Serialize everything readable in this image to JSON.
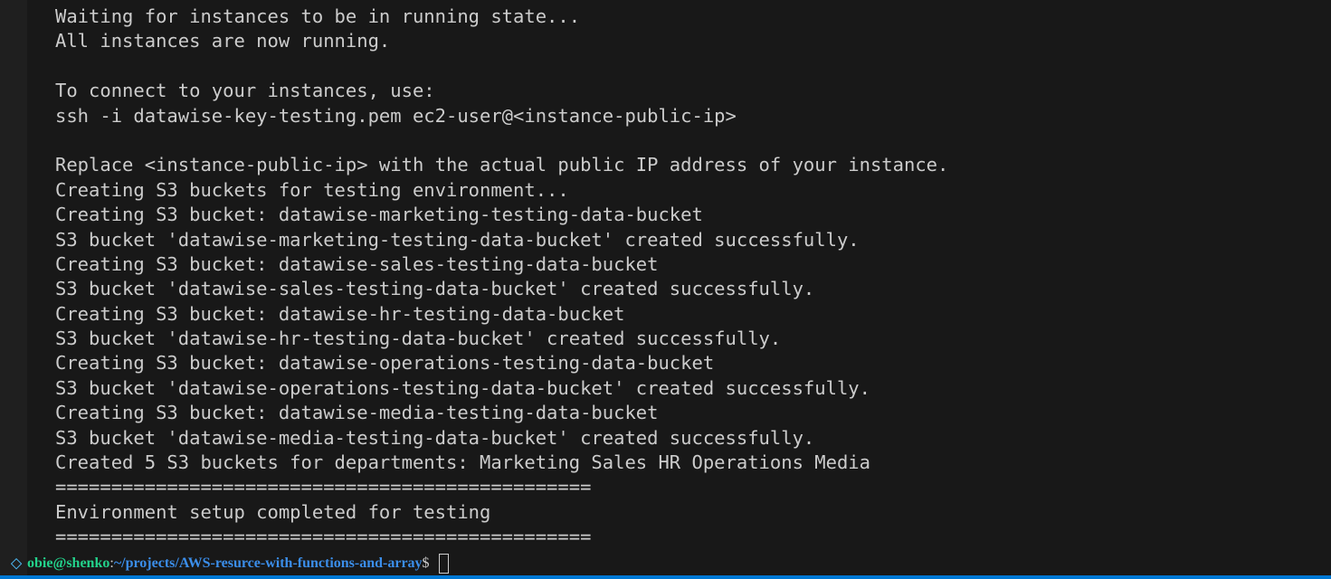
{
  "terminal": {
    "lines": [
      "Waiting for instances to be in running state...",
      "All instances are now running.",
      "",
      "To connect to your instances, use:",
      "ssh -i datawise-key-testing.pem ec2-user@<instance-public-ip>",
      "",
      "Replace <instance-public-ip> with the actual public IP address of your instance.",
      "Creating S3 buckets for testing environment...",
      "Creating S3 bucket: datawise-marketing-testing-data-bucket",
      "S3 bucket 'datawise-marketing-testing-data-bucket' created successfully.",
      "Creating S3 bucket: datawise-sales-testing-data-bucket",
      "S3 bucket 'datawise-sales-testing-data-bucket' created successfully.",
      "Creating S3 bucket: datawise-hr-testing-data-bucket",
      "S3 bucket 'datawise-hr-testing-data-bucket' created successfully.",
      "Creating S3 bucket: datawise-operations-testing-data-bucket",
      "S3 bucket 'datawise-operations-testing-data-bucket' created successfully.",
      "Creating S3 bucket: datawise-media-testing-data-bucket",
      "S3 bucket 'datawise-media-testing-data-bucket' created successfully.",
      "Created 5 S3 buckets for departments: Marketing Sales HR Operations Media",
      "================================================",
      "Environment setup completed for testing",
      "================================================"
    ],
    "prompt": {
      "icon": "shell-integration-icon",
      "icon_glyph": "⬦",
      "user_host": "obie@shenko",
      "colon": ":",
      "path": "~/projects/AWS-resurce-with-functions-and-array",
      "symbol": "$"
    }
  },
  "colors": {
    "background": "#181818",
    "foreground": "#cccccc",
    "user_host": "#23d18b",
    "path": "#3b8eea",
    "status_strip": "#0078d4"
  }
}
